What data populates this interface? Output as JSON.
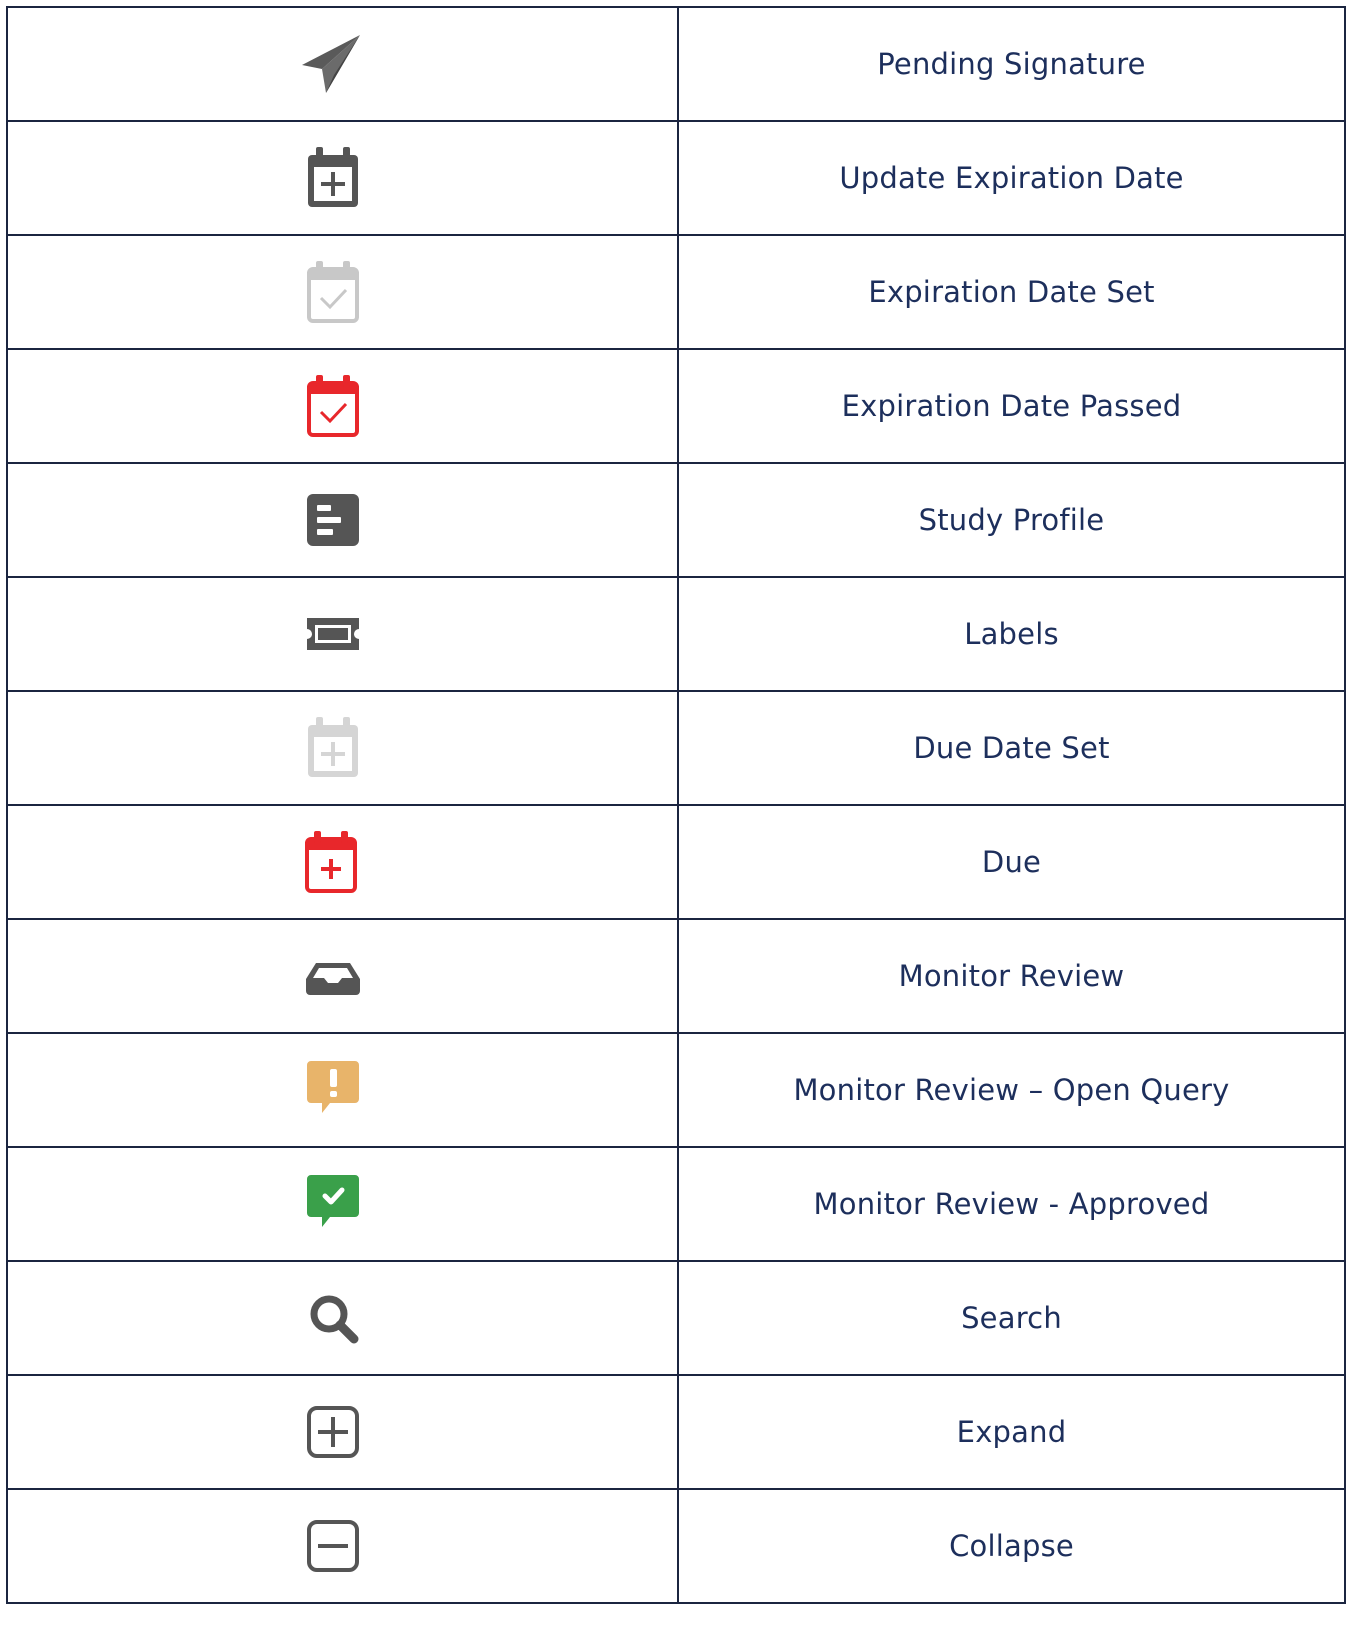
{
  "colors": {
    "border": "#1b2540",
    "label_text": "#1d2f5c",
    "icon_dark": "#555555",
    "icon_light": "#cccccc",
    "icon_red": "#e8272b",
    "icon_amber": "#e8b46a",
    "icon_green": "#3aa04a"
  },
  "rows": [
    {
      "icon": "paper-plane-icon",
      "label": "Pending Signature"
    },
    {
      "icon": "calendar-plus-icon",
      "label": "Update Expiration Date"
    },
    {
      "icon": "calendar-check-light-icon",
      "label": "Expiration Date Set"
    },
    {
      "icon": "calendar-check-red-icon",
      "label": "Expiration Date Passed"
    },
    {
      "icon": "profile-card-icon",
      "label": "Study Profile"
    },
    {
      "icon": "ticket-icon",
      "label": "Labels"
    },
    {
      "icon": "calendar-plus-light-icon",
      "label": "Due Date Set"
    },
    {
      "icon": "calendar-plus-red-icon",
      "label": "Due"
    },
    {
      "icon": "inbox-tray-icon",
      "label": "Monitor Review"
    },
    {
      "icon": "comment-exclamation-icon",
      "label": "Monitor Review – Open Query"
    },
    {
      "icon": "comment-check-icon",
      "label": "Monitor Review - Approved"
    },
    {
      "icon": "search-icon",
      "label": "Search"
    },
    {
      "icon": "plus-square-icon",
      "label": "Expand"
    },
    {
      "icon": "minus-square-icon",
      "label": "Collapse"
    }
  ]
}
